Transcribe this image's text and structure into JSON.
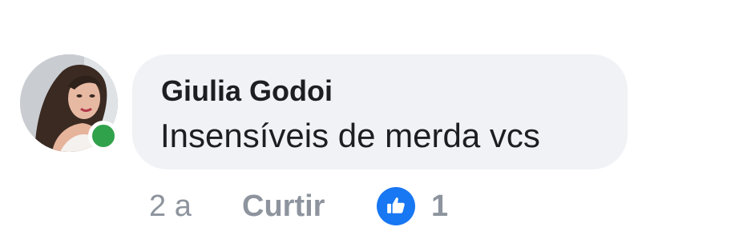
{
  "comment": {
    "author": "Giulia Godoi",
    "text": "Insensíveis de merda vcs",
    "online": true,
    "timestamp": "2 a",
    "like_label": "Curtir",
    "reactions": {
      "icon": "like-icon",
      "count": "1"
    }
  },
  "colors": {
    "bubble": "#f0f2f5",
    "text": "#1c1e21",
    "muted": "#8d949e",
    "online": "#31a24c",
    "like_blue": "#1877f2"
  }
}
